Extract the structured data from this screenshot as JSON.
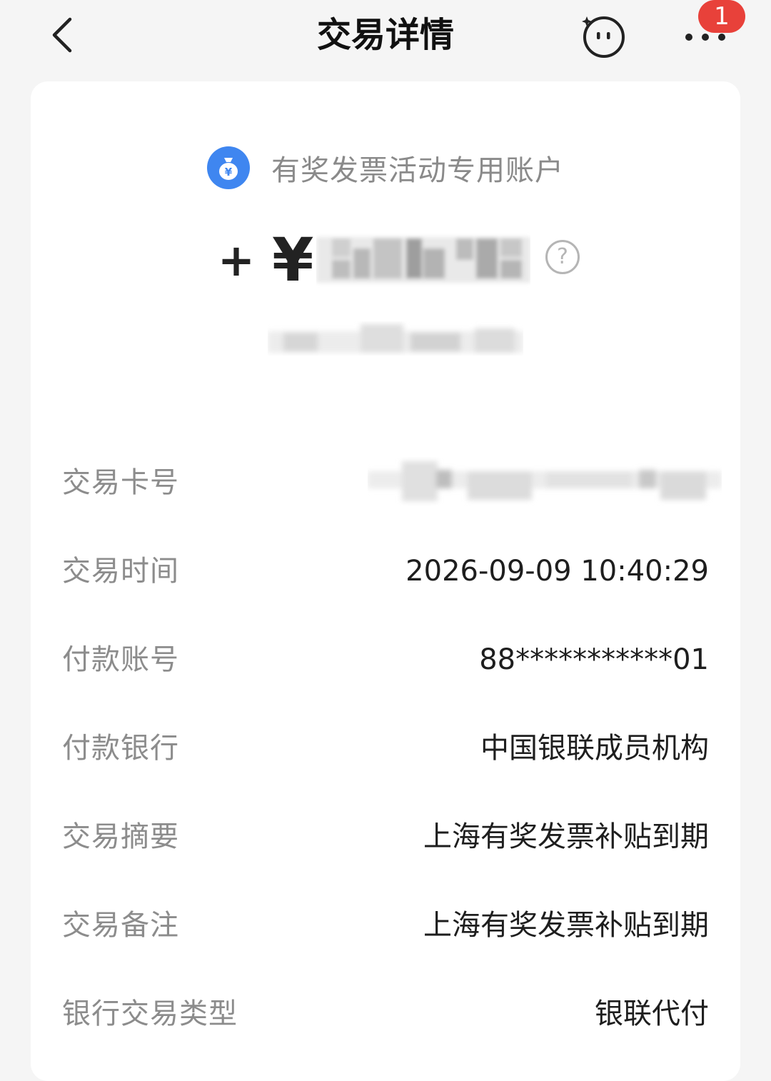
{
  "header": {
    "title": "交易详情",
    "back_icon": "chevron-left-icon",
    "service_icon": "smiley-assistant-icon",
    "more_icon": "more-dots-icon",
    "notification_count": "1"
  },
  "account": {
    "icon": "money-bag-yuan-icon",
    "name": "有奖发票活动专用账户"
  },
  "amount": {
    "sign": "+",
    "currency": "¥",
    "value_redacted": true,
    "help_icon": "question-circle-icon",
    "help_symbol": "?"
  },
  "details": [
    {
      "label": "交易卡号",
      "value": "",
      "redacted": true
    },
    {
      "label": "交易时间",
      "value": "2026-09-09 10:40:29"
    },
    {
      "label": "付款账号",
      "value": "88***********01"
    },
    {
      "label": "付款银行",
      "value": "中国银联成员机构"
    },
    {
      "label": "交易摘要",
      "value": "上海有奖发票补贴到期"
    },
    {
      "label": "交易备注",
      "value": "上海有奖发票补贴到期"
    },
    {
      "label": "银行交易类型",
      "value": "银联代付"
    }
  ],
  "colors": {
    "background": "#f5f5f5",
    "card": "#ffffff",
    "accent_blue": "#3f86f0",
    "badge_red": "#e8413a",
    "label_gray": "#8c8c8c"
  }
}
